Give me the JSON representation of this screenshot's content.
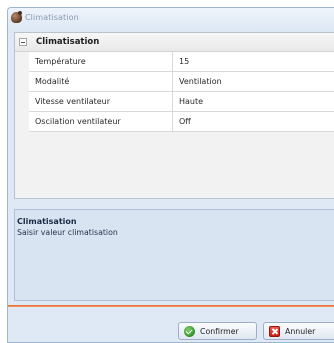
{
  "window": {
    "title": "Climatisation",
    "icon": "app-logo-icon"
  },
  "property_grid": {
    "category": "Climatisation",
    "rows": [
      {
        "name": "Température",
        "value": "15"
      },
      {
        "name": "Modalité",
        "value": "Ventilation"
      },
      {
        "name": "Vitesse ventilateur",
        "value": "Haute"
      },
      {
        "name": "Oscilation ventilateur",
        "value": "Off"
      }
    ]
  },
  "description": {
    "title": "Climatisation",
    "text": "Saisir valeur climatisation"
  },
  "buttons": {
    "confirm_label": "Confirmer",
    "cancel_label": "Annuler"
  },
  "colors": {
    "accent_separator": "#e9642a",
    "description_bg": "#d9e4f2",
    "window_bg": "#dfe9f5"
  }
}
